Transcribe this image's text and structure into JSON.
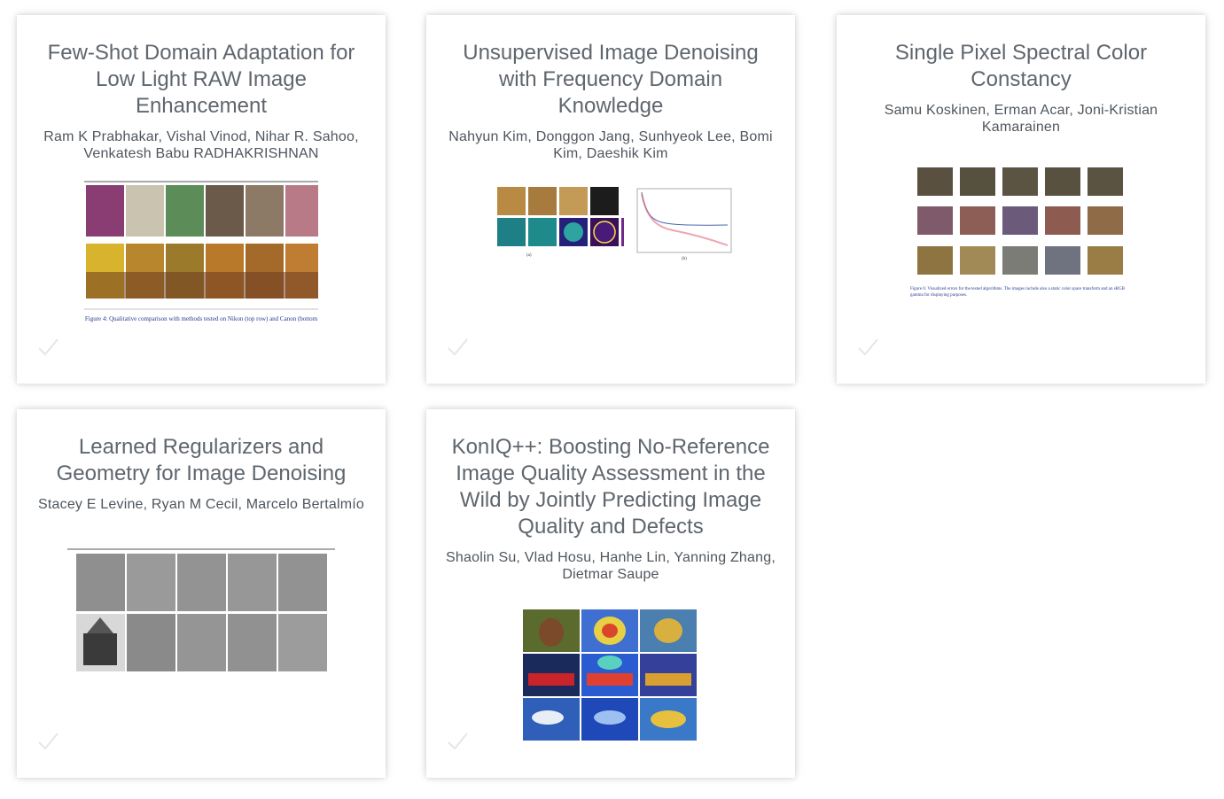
{
  "cards": [
    {
      "title": "Few-Shot Domain Adaptation for Low Light RAW Image Enhancement",
      "authors": "Ram K Prabhakar, Vishal Vinod, Nihar R. Sahoo, Venkatesh Babu RADHAKRISHNAN",
      "figure_caption": "Figure 4: Qualitative comparison with methods tested on Nikon (top row) and Canon (bottom"
    },
    {
      "title": "Unsupervised Image Denoising with Frequency Domain Knowledge",
      "authors": "Nahyun Kim, Donggon Jang, Sunhyeok Lee, Bomi Kim, Daeshik Kim"
    },
    {
      "title": "Single Pixel Spectral Color Constancy",
      "authors": "Samu Koskinen, Erman Acar, Joni-Kristian Kamarainen",
      "figure_caption": "Figure 6: Visualized errors for the tested algorithms. The images include also a static color space transform and an sRGB gamma for displaying purposes."
    },
    {
      "title": "Learned Regularizers and Geometry for Image Denoising",
      "authors": "Stacey E Levine, Ryan M Cecil, Marcelo Bertalmío"
    },
    {
      "title": "KonIQ++: Boosting No-Reference Image Quality Assessment in the Wild by Jointly Predicting Image Quality and Defects",
      "authors": "Shaolin Su, Vlad Hosu, Hanhe Lin, Yanning Zhang, Dietmar Saupe"
    }
  ],
  "icons": {
    "check": "check-icon"
  },
  "colors": {
    "title": "#5f666d",
    "authors": "#4f565d",
    "check": "#e4e6e8",
    "caption": "#2a3a8a"
  }
}
